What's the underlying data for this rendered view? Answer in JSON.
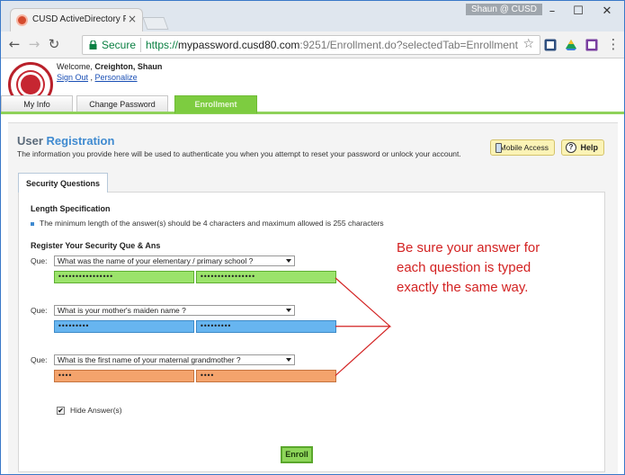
{
  "browser": {
    "tab_title": "CUSD ActiveDirectory Pa",
    "tab_close": "×",
    "user_badge": "Shaun @ CUSD",
    "secure_label": "Secure",
    "url_scheme": "https://",
    "url_host": "mypassword.cusd80.com",
    "url_rest": ":9251/Enrollment.do?selectedTab=Enrollment",
    "colors": {
      "secure": "#0b8043",
      "tabstrip": "#dfe6ee"
    }
  },
  "header": {
    "welcome_prefix": "Welcome, ",
    "user_name": "Creighton, Shaun",
    "sign_out": "Sign Out",
    "separator": " , ",
    "personalize": "Personalize"
  },
  "nav_tabs": [
    {
      "label": "My Info"
    },
    {
      "label": "Change Password"
    },
    {
      "label": "Enrollment",
      "active": true
    }
  ],
  "main": {
    "title_part1": "User",
    "title_part2": "Registration",
    "description": "The information you provide here will be used to authenticate you when you attempt to reset your password or unlock your account.",
    "mobile_access": "Mobile Access",
    "help": "Help",
    "subtab": "Security Questions",
    "length_heading": "Length Specification",
    "length_text": "The minimum length of the answer(s) should be 4 characters and maximum allowed is 255 characters",
    "register_heading": "Register Your Security Que & Ans",
    "que_label": "Que:",
    "questions": [
      {
        "question": "What was the name of your elementary / primary school ?",
        "answer": "••••••••••••••••",
        "confirm": "••••••••••••••••",
        "color": "green"
      },
      {
        "question": "What is your mother's maiden name ?",
        "answer": "•••••••••",
        "confirm": "•••••••••",
        "color": "blue"
      },
      {
        "question": "What is the first name of your maternal grandmother ?",
        "answer": "••••",
        "confirm": "••••",
        "color": "orange"
      }
    ],
    "hide_answers": "Hide Answer(s)",
    "hide_checked": "✔",
    "enroll": "Enroll"
  },
  "annotation": {
    "line1": "Be sure your answer for",
    "line2": "each question is typed",
    "line3": "exactly the same way.",
    "color": "#d32222"
  }
}
